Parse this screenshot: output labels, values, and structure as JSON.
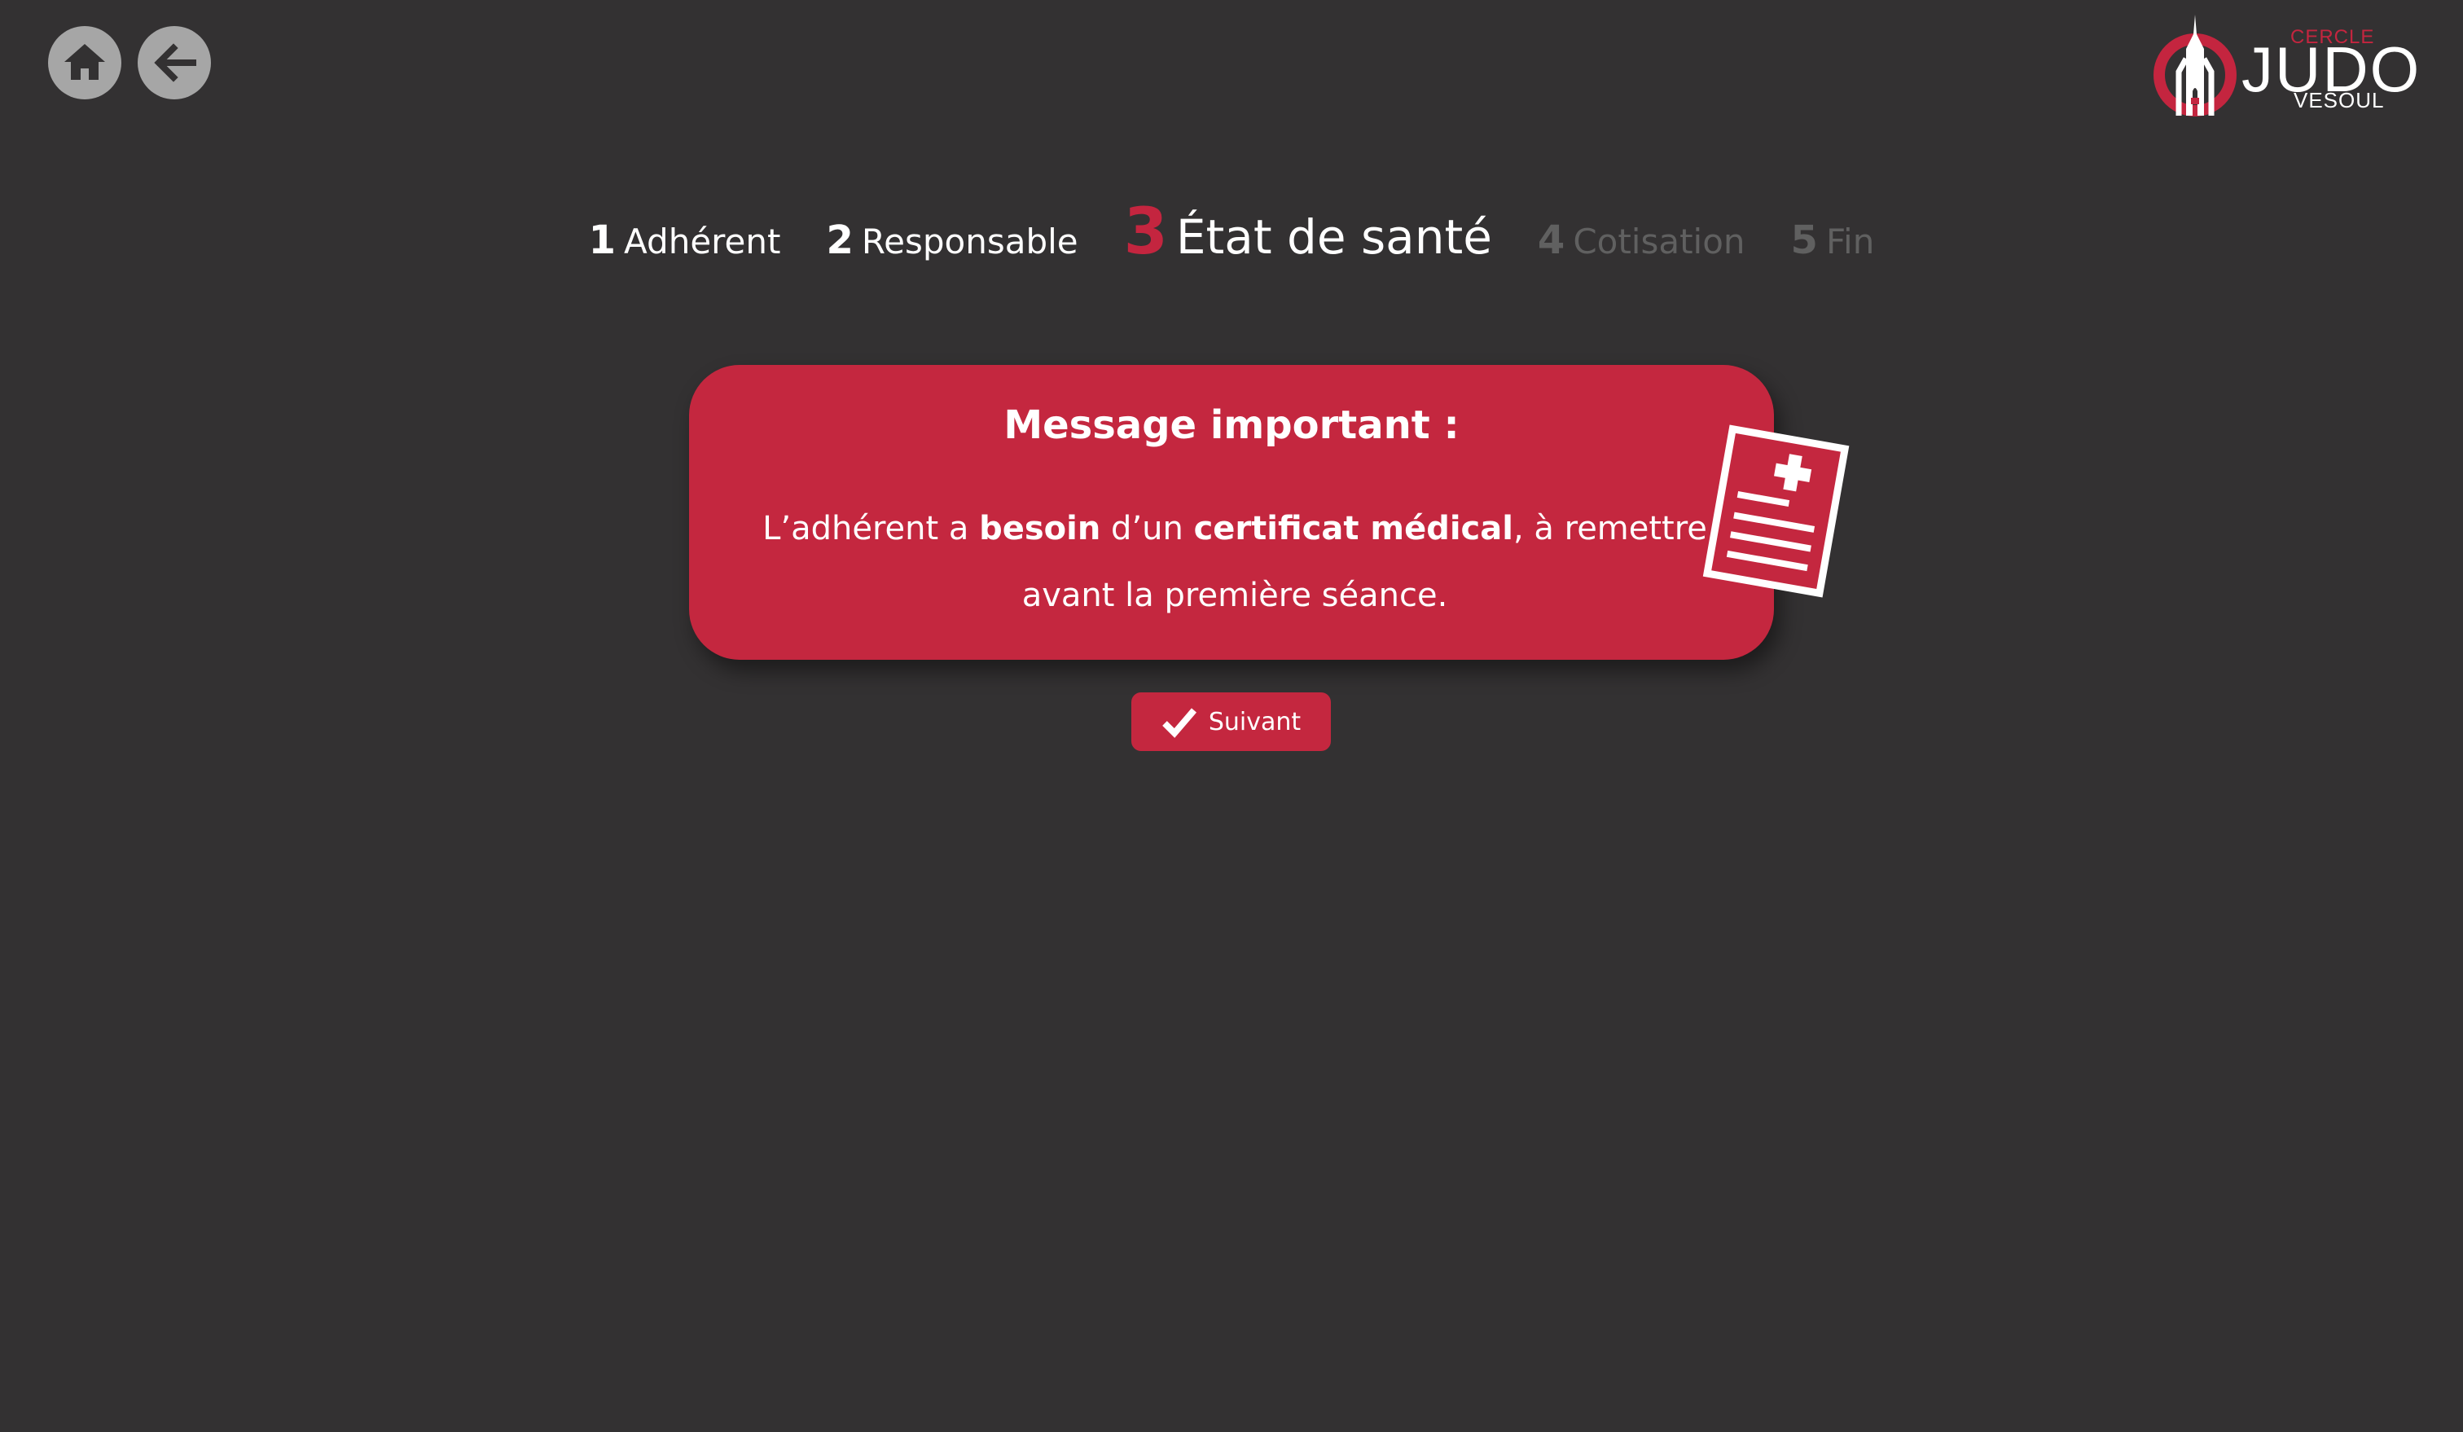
{
  "nav": {
    "home_icon": "home-icon",
    "back_icon": "arrow-left-icon"
  },
  "logo": {
    "top": "CERCLE",
    "main": "JUDO",
    "bottom": "VESOUL"
  },
  "steps": [
    {
      "number": "1",
      "label": "Adhérent",
      "state": "done"
    },
    {
      "number": "2",
      "label": "Responsable",
      "state": "done"
    },
    {
      "number": "3",
      "label": "État de santé",
      "state": "current"
    },
    {
      "number": "4",
      "label": "Cotisation",
      "state": "todo"
    },
    {
      "number": "5",
      "label": "Fin",
      "state": "todo"
    }
  ],
  "message": {
    "title": "Message important :",
    "part1": "L’adhérent a ",
    "bold1": "besoin",
    "part2": " d’un ",
    "bold2": "certificat médical",
    "part3": ", à remettre avant la première séance.",
    "icon": "medical-certificate-icon"
  },
  "next_button": {
    "label": "Suivant",
    "icon": "check-icon"
  },
  "colors": {
    "background": "#333132",
    "accent": "#c4273f",
    "nav_button": "#a6a6a6",
    "inactive_step": "#606060"
  }
}
